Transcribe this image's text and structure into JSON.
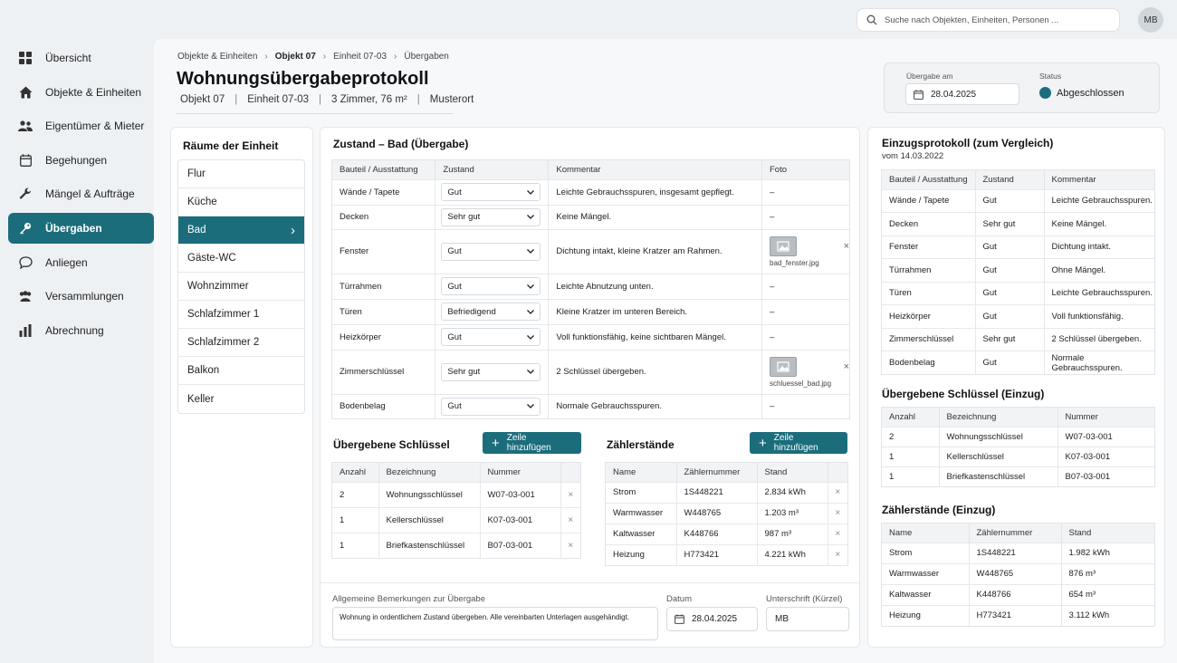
{
  "nav": [
    {
      "label": "Übersicht",
      "icon": "grid-icon"
    },
    {
      "label": "Objekte & Einheiten",
      "icon": "home-icon"
    },
    {
      "label": "Eigentümer & Mieter",
      "icon": "people-icon"
    },
    {
      "label": "Begehungen",
      "icon": "calendar-icon"
    },
    {
      "label": "Mängel & Aufträge",
      "icon": "wrench-icon"
    },
    {
      "label": "Übergaben",
      "icon": "key-icon"
    },
    {
      "label": "Anliegen",
      "icon": "chat-icon"
    },
    {
      "label": "Versammlungen",
      "icon": "group-icon"
    },
    {
      "label": "Abrechnung",
      "icon": "bar-chart-icon"
    }
  ],
  "search": {
    "placeholder": "Suche nach Objekten, Einheiten, Personen ..."
  },
  "user": {
    "initials": "MB"
  },
  "breadcrumb": [
    "Objekte & Einheiten",
    "Objekt 07",
    "Einheit 07-03",
    "Übergaben"
  ],
  "page": {
    "title": "Wohnungsübergabeprotokoll",
    "info": [
      "Objekt 07",
      "Einheit 07-03",
      "3 Zimmer, 76 m²",
      "Musterort"
    ]
  },
  "handover": {
    "date_label": "Übergabe am",
    "date": "28.04.2025",
    "status_label": "Status",
    "status": "Abgeschlossen",
    "status_color": "#1b6d7c"
  },
  "rooms": {
    "title": "Räume der Einheit",
    "items": [
      "Flur",
      "Küche",
      "Bad",
      "Gäste-WC",
      "Wohnzimmer",
      "Schlafzimmer 1",
      "Schlafzimmer 2",
      "Balkon",
      "Keller"
    ],
    "active": "Bad"
  },
  "condition": {
    "title": "Zustand – Bad (Übergabe)",
    "headers": [
      "Bauteil / Ausstattung",
      "Zustand",
      "Kommentar",
      "Foto"
    ],
    "rows": [
      {
        "part": "Wände / Tapete",
        "state": "Gut",
        "comment": "Leichte Gebrauchsspuren, insgesamt gepflegt.",
        "photo": "–"
      },
      {
        "part": "Decken",
        "state": "Sehr gut",
        "comment": "Keine Mängel.",
        "photo": "–"
      },
      {
        "part": "Fenster",
        "state": "Gut",
        "comment": "Dichtung intakt, kleine Kratzer am Rahmen.",
        "photo": "bad_fenster.jpg"
      },
      {
        "part": "Türrahmen",
        "state": "Gut",
        "comment": "Leichte Abnutzung unten.",
        "photo": "–"
      },
      {
        "part": "Türen",
        "state": "Befriedigend",
        "comment": "Kleine Kratzer im unteren Bereich.",
        "photo": "–"
      },
      {
        "part": "Heizkörper",
        "state": "Gut",
        "comment": "Voll funktionsfähig, keine sichtbaren Mängel.",
        "photo": "–"
      },
      {
        "part": "Zimmerschlüssel",
        "state": "Sehr gut",
        "comment": "2 Schlüssel übergeben.",
        "photo": "schluessel_bad.jpg"
      },
      {
        "part": "Bodenbelag",
        "state": "Gut",
        "comment": "Normale Gebrauchsspuren.",
        "photo": "–"
      }
    ]
  },
  "keys": {
    "title": "Übergebene Schlüssel",
    "add_label": "Zeile hinzufügen",
    "headers": [
      "Anzahl",
      "Bezeichnung",
      "Nummer"
    ],
    "rows": [
      {
        "count": "2",
        "name": "Wohnungsschlüssel",
        "number": "W07-03-001"
      },
      {
        "count": "1",
        "name": "Kellerschlüssel",
        "number": "K07-03-001"
      },
      {
        "count": "1",
        "name": "Briefkastenschlüssel",
        "number": "B07-03-001"
      }
    ]
  },
  "meters": {
    "title": "Zählerstände",
    "add_label": "Zeile hinzufügen",
    "headers": [
      "Name",
      "Zählernummer",
      "Stand"
    ],
    "rows": [
      {
        "name": "Strom",
        "number": "1S448221",
        "value": "2.834 kWh"
      },
      {
        "name": "Warmwasser",
        "number": "W448765",
        "value": "1.203 m³"
      },
      {
        "name": "Kaltwasser",
        "number": "K448766",
        "value": "987 m³"
      },
      {
        "name": "Heizung",
        "number": "H773421",
        "value": "4.221 kWh"
      }
    ]
  },
  "footer": {
    "remarks_label": "Allgemeine Bemerkungen zur Übergabe",
    "remarks": "Wohnung in ordentlichem Zustand übergeben. Alle vereinbarten Unterlagen ausgehändigt.",
    "date_label": "Datum",
    "date": "28.04.2025",
    "signature_label": "Unterschrift (Kürzel)",
    "signature": "MB"
  },
  "compare": {
    "title": "Einzugsprotokoll (zum Vergleich)",
    "subtitle": "vom 14.03.2022",
    "headers": [
      "Bauteil / Ausstattung",
      "Zustand",
      "Kommentar"
    ],
    "rows": [
      {
        "part": "Wände / Tapete",
        "state": "Gut",
        "comment": "Leichte Gebrauchsspuren."
      },
      {
        "part": "Decken",
        "state": "Sehr gut",
        "comment": "Keine Mängel."
      },
      {
        "part": "Fenster",
        "state": "Gut",
        "comment": "Dichtung intakt."
      },
      {
        "part": "Türrahmen",
        "state": "Gut",
        "comment": "Ohne Mängel."
      },
      {
        "part": "Türen",
        "state": "Gut",
        "comment": "Leichte Gebrauchsspuren."
      },
      {
        "part": "Heizkörper",
        "state": "Gut",
        "comment": "Voll funktionsfähig."
      },
      {
        "part": "Zimmerschlüssel",
        "state": "Sehr gut",
        "comment": "2 Schlüssel übergeben."
      },
      {
        "part": "Bodenbelag",
        "state": "Gut",
        "comment": "Normale Gebrauchsspuren."
      }
    ],
    "keys_title": "Übergebene Schlüssel (Einzug)",
    "keys_headers": [
      "Anzahl",
      "Bezeichnung",
      "Nummer"
    ],
    "keys": [
      {
        "count": "2",
        "name": "Wohnungsschlüssel",
        "number": "W07-03-001"
      },
      {
        "count": "1",
        "name": "Kellerschlüssel",
        "number": "K07-03-001"
      },
      {
        "count": "1",
        "name": "Briefkastenschlüssel",
        "number": "B07-03-001"
      }
    ],
    "meters_title": "Zählerstände (Einzug)",
    "meters_headers": [
      "Name",
      "Zählernummer",
      "Stand"
    ],
    "meters": [
      {
        "name": "Strom",
        "number": "1S448221",
        "value": "1.982 kWh"
      },
      {
        "name": "Warmwasser",
        "number": "W448765",
        "value": "876 m³"
      },
      {
        "name": "Kaltwasser",
        "number": "K448766",
        "value": "654 m³"
      },
      {
        "name": "Heizung",
        "number": "H773421",
        "value": "3.112 kWh"
      }
    ]
  }
}
